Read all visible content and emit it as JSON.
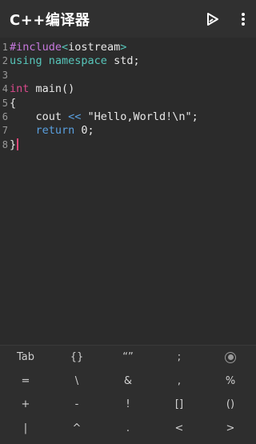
{
  "app": {
    "title": "C++编译器"
  },
  "toolbar": {
    "run_icon": "run-icon",
    "more_icon": "more-vert-icon"
  },
  "editor": {
    "line_numbers": [
      "1",
      "2",
      "3",
      "4",
      "5",
      "6",
      "7",
      "8"
    ],
    "lines": [
      {
        "parts": [
          "#include",
          "<",
          "iostream",
          ">"
        ]
      },
      {
        "parts": [
          "using",
          " ",
          "namespace",
          " std;"
        ]
      },
      {
        "parts": [
          ""
        ]
      },
      {
        "parts": [
          "int",
          " main()"
        ]
      },
      {
        "parts": [
          "{"
        ]
      },
      {
        "parts": [
          "    cout ",
          "<<",
          " \"Hello,World!\\n\";"
        ]
      },
      {
        "parts": [
          "    ",
          "return",
          " 0;"
        ]
      },
      {
        "parts": [
          "}"
        ]
      }
    ],
    "cursor_line": 8
  },
  "keyboard": {
    "rows": [
      [
        "Tab",
        "{}",
        "“”",
        ";",
        "radio-icon"
      ],
      [
        "=",
        "\\",
        "&",
        ",",
        "%"
      ],
      [
        "+",
        "-",
        "!",
        "[]",
        "()"
      ],
      [
        "|",
        "^",
        ".",
        "<",
        ">"
      ]
    ]
  },
  "colors": {
    "background": "#2b2b2b",
    "appbar": "#303030",
    "keyword_purple": "#c678dd",
    "namespace_teal": "#57c6ba",
    "type_pink": "#d94a8c",
    "operator_blue": "#5aa0e0",
    "cursor": "#e0487a"
  }
}
